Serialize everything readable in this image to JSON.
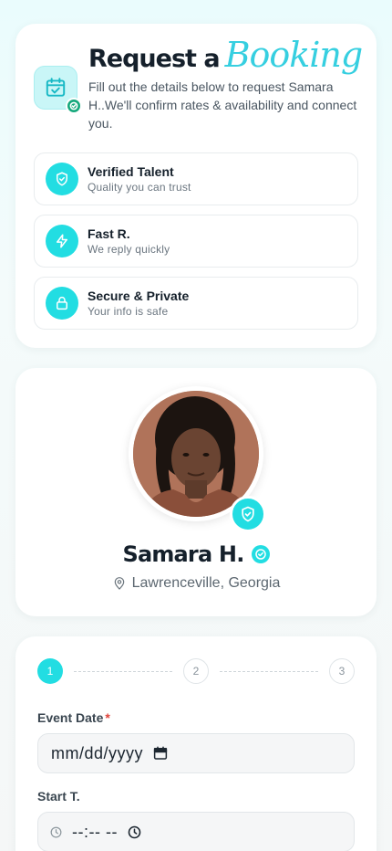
{
  "intro": {
    "title_main": "Request a",
    "title_script": "Booking",
    "description": "Fill out the details below to request Samara H..We'll confirm rates & availability and connect you.",
    "features": [
      {
        "title": "Verified Talent",
        "subtitle": "Quality you can trust",
        "icon": "shield-check-icon"
      },
      {
        "title": "Fast R.",
        "subtitle": "We reply quickly",
        "icon": "lightning-icon"
      },
      {
        "title": "Secure & Private",
        "subtitle": "Your info is safe",
        "icon": "lock-icon"
      }
    ]
  },
  "profile": {
    "name": "Samara H.",
    "location": "Lawrenceville, Georgia"
  },
  "form": {
    "steps": [
      "1",
      "2",
      "3"
    ],
    "current_step": 1,
    "event_date_label": "Event Date",
    "event_date_required": "*",
    "event_date_value": "mm/dd/yyyy",
    "start_time_label": "Start T.",
    "start_time_value": "--:-- --"
  },
  "colors": {
    "accent": "#22dde2",
    "accent_script": "#36cfe0",
    "success": "#15a87c",
    "required": "#e0433a"
  }
}
